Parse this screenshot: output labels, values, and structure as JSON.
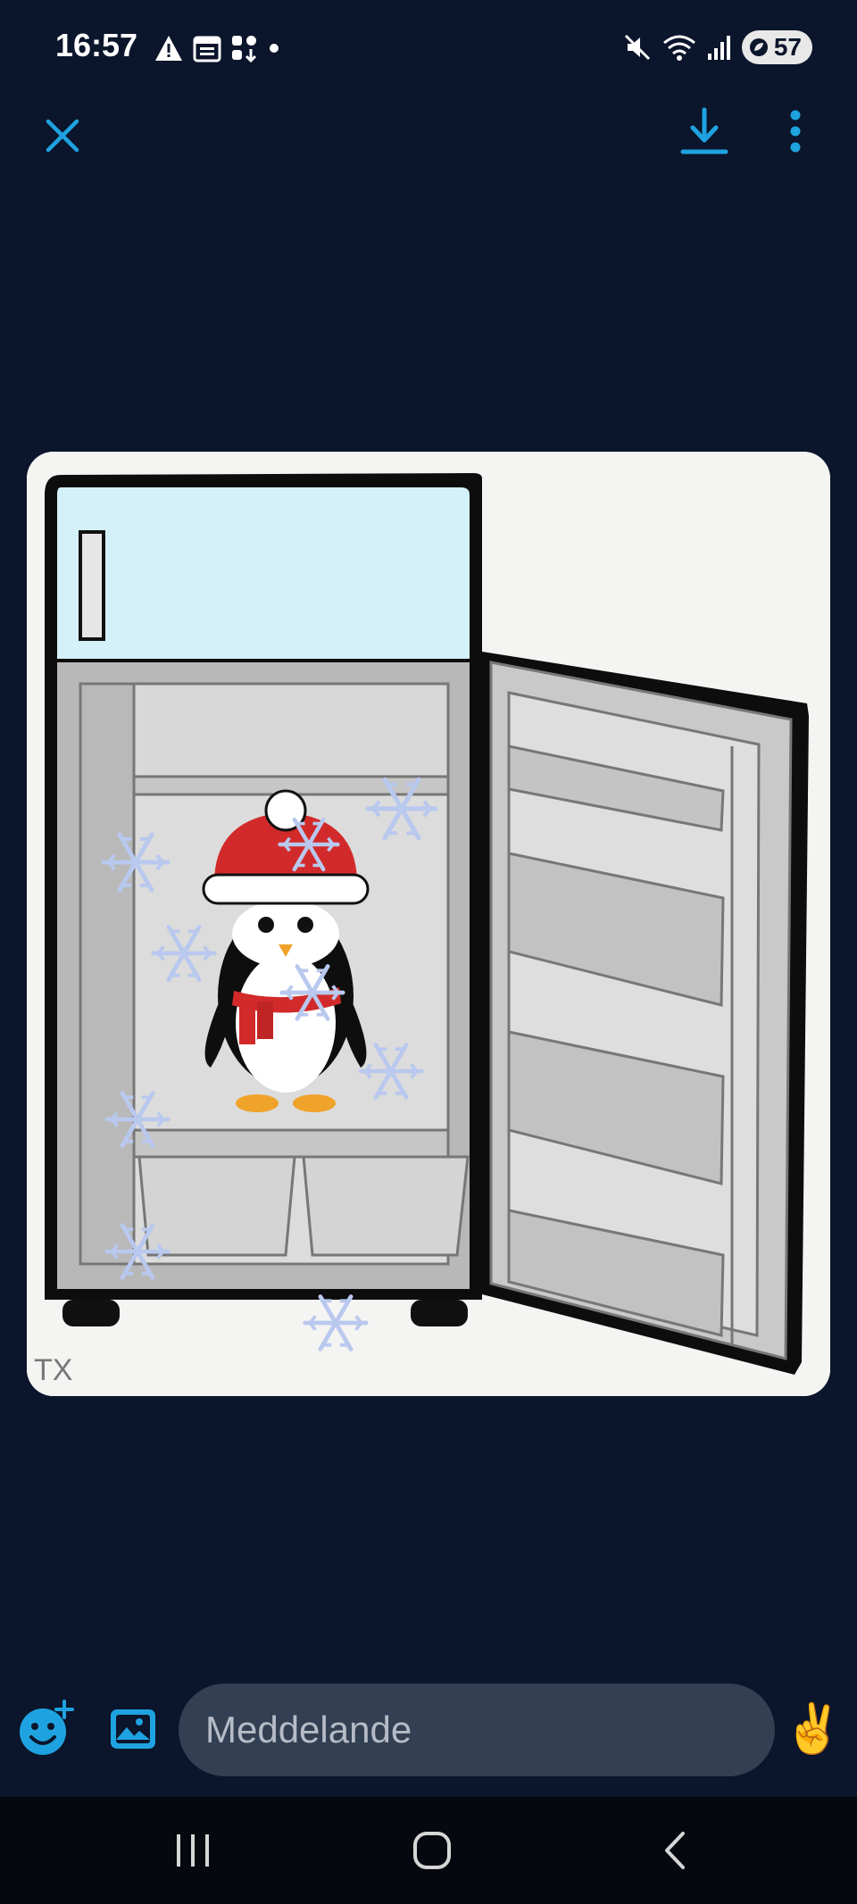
{
  "status_bar": {
    "time": "16:57",
    "battery": "57",
    "left_icons": [
      "warning-icon",
      "calendar-icon",
      "apps-icon",
      "dot-icon"
    ],
    "right_icons": [
      "mute-icon",
      "wifi-icon",
      "signal-icon",
      "battery-icon"
    ]
  },
  "top_bar": {
    "close_icon": "close-icon",
    "download_icon": "download-icon",
    "more_icon": "more-vert-icon",
    "accent": "#1fa3e0"
  },
  "image": {
    "signature": "TX"
  },
  "compose": {
    "placeholder": "Meddelande",
    "emoji_add_icon": "emoji-add-icon",
    "gallery_icon": "gallery-icon",
    "victory_emoji": "✌️"
  },
  "nav_bar": {
    "icons": [
      "recents-icon",
      "home-icon",
      "back-icon"
    ]
  }
}
